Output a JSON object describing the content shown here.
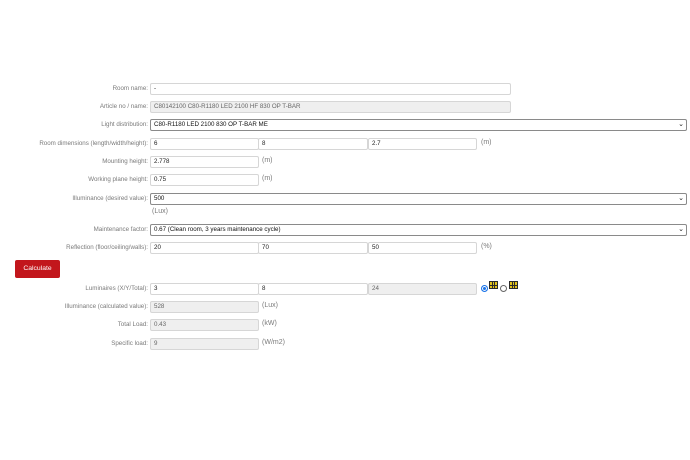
{
  "form": {
    "room_name": {
      "label": "Room name:",
      "value": "-"
    },
    "article": {
      "label": "Article no / name:",
      "value": "C80142100 C80-R1180 LED 2100 HF 830 OP T-BAR"
    },
    "light_distribution": {
      "label": "Light distribution:",
      "value": "C80-R1180 LED 2100 830 OP T-BAR ME"
    },
    "room_dimensions": {
      "label": "Room dimensions (length/width/height):",
      "length": "6",
      "width": "8",
      "height": "2.7",
      "unit": "(m)"
    },
    "mounting_height": {
      "label": "Mounting height:",
      "value": "2.778",
      "unit": "(m)"
    },
    "working_plane_height": {
      "label": "Working plane height:",
      "value": "0.75",
      "unit": "(m)"
    },
    "illuminance_desired": {
      "label": "Illuminance (desired value):",
      "value": "500",
      "unit": "(Lux)"
    },
    "maintenance_factor": {
      "label": "Maintenance factor:",
      "value": "0.67 (Clean room, 3 years maintenance cycle)"
    },
    "reflection": {
      "label": "Reflection (floor/ceiling/walls):",
      "floor": "20",
      "ceiling": "70",
      "walls": "50",
      "unit": "(%)"
    }
  },
  "calculate_button": "Calculate",
  "results": {
    "luminaires": {
      "label": "Luminaires (X/Y/Total):",
      "x": "3",
      "y": "8",
      "total": "24"
    },
    "illuminance_calculated": {
      "label": "Illuminance (calculated value):",
      "value": "528",
      "unit": "(Lux)"
    },
    "total_load": {
      "label": "Total Load:",
      "value": "0.43",
      "unit": "(kW)"
    },
    "specific_load": {
      "label": "Specific load:",
      "value": "9",
      "unit": "(W/m2)"
    }
  },
  "colors": {
    "button": "#c2161c",
    "icon_fill": "#e3c21a"
  },
  "icons": [
    "luminaire-grid-icon",
    "luminaire-grid-alt-icon",
    "chevron-down-icon"
  ]
}
